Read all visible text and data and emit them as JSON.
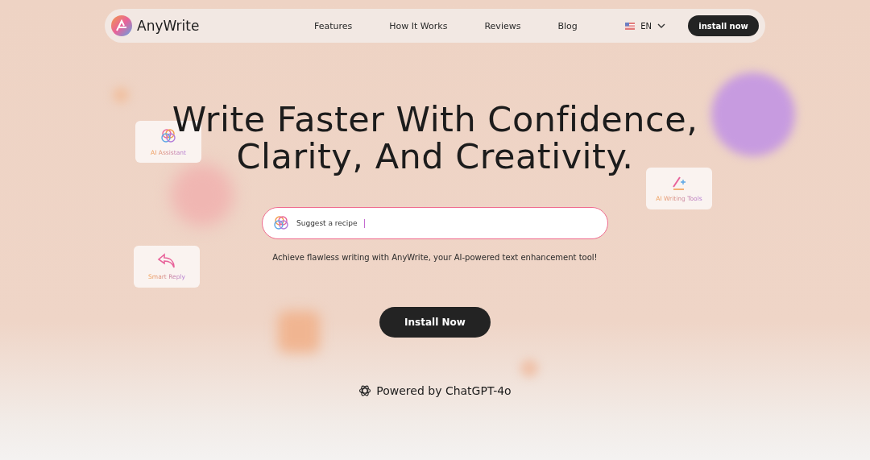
{
  "nav": {
    "brand": "AnyWrite",
    "links": [
      "Features",
      "How It Works",
      "Reviews",
      "Blog"
    ],
    "language": "EN",
    "cta": "install now"
  },
  "hero": {
    "title_lines": [
      "Write Faster With Confidence,",
      "Clarity, And Creativity."
    ],
    "prompt": {
      "value": "Suggest a recipe"
    },
    "subtitle": "Achieve flawless writing with AnyWrite, your AI-powered text enhancement tool!",
    "cta": "Install Now",
    "powered_by": "Powered by ChatGPT-4o"
  },
  "floating_cards": [
    {
      "kind": "assistant",
      "label": "AI Assistant"
    },
    {
      "kind": "reply",
      "label": "Smart Reply"
    },
    {
      "kind": "writing",
      "label": "AI Writing Tools"
    }
  ]
}
